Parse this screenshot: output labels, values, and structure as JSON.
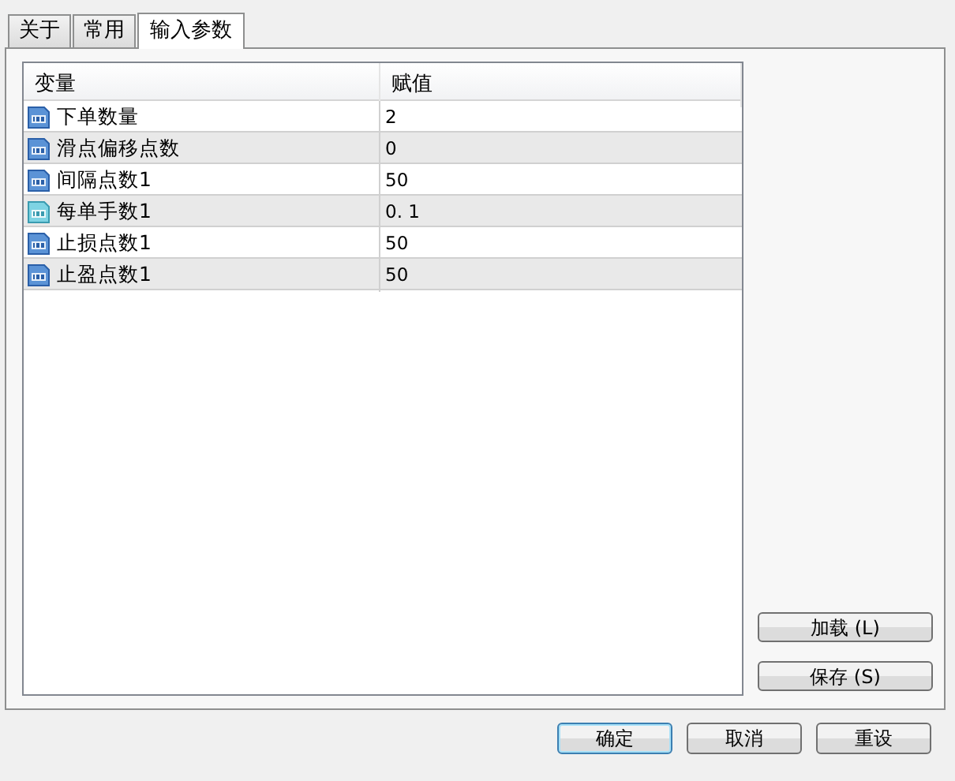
{
  "tabs": [
    {
      "label": "关于",
      "selected": false
    },
    {
      "label": "常用",
      "selected": false
    },
    {
      "label": "输入参数",
      "selected": true
    }
  ],
  "table": {
    "columns": [
      "变量",
      "赋值"
    ],
    "rows": [
      {
        "kind": "int",
        "name": "下单数量",
        "value": "2"
      },
      {
        "kind": "int",
        "name": "滑点偏移点数",
        "value": "0"
      },
      {
        "kind": "int",
        "name": "间隔点数1",
        "value": "50"
      },
      {
        "kind": "double",
        "name": "每单手数1",
        "value": "0. 1"
      },
      {
        "kind": "int",
        "name": "止损点数1",
        "value": "50"
      },
      {
        "kind": "int",
        "name": "止盈点数1",
        "value": "50"
      }
    ]
  },
  "side_buttons": [
    "加载 (L)",
    "保存 (S)"
  ],
  "buttons": [
    {
      "label": "确定",
      "default": true
    },
    {
      "label": "取消",
      "default": false
    },
    {
      "label": "重设",
      "default": false
    }
  ]
}
